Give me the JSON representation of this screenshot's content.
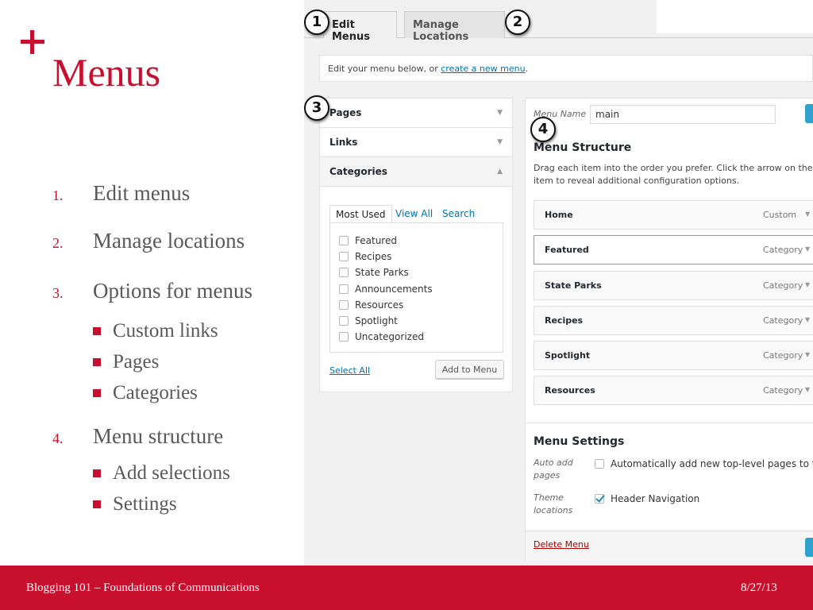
{
  "slide": {
    "title": "Menus",
    "outline": [
      {
        "num": "1.",
        "text": "Edit menus",
        "subs": []
      },
      {
        "num": "2.",
        "text": "Manage locations",
        "subs": []
      },
      {
        "num": "3.",
        "text": "Options for menus",
        "subs": [
          "Custom links",
          "Pages",
          "Categories"
        ]
      },
      {
        "num": "4.",
        "text": "Menu structure",
        "subs": [
          "Add selections",
          "Settings"
        ]
      }
    ],
    "footer": "Blogging 101 – Foundations of Communications",
    "date": "8/27/13",
    "accent_color": "#c8102e"
  },
  "screenshot": {
    "tabs": [
      "Edit Menus",
      "Manage Locations"
    ],
    "notice": {
      "prefix": "Edit your menu below, or ",
      "link": "create a new menu",
      "suffix": "."
    },
    "sections": {
      "pages": "Pages",
      "links": "Links",
      "categories": "Categories"
    },
    "category_tabs": [
      "Most Used",
      "View All",
      "Search"
    ],
    "categories": [
      "Featured",
      "Recipes",
      "State Parks",
      "Announcements",
      "Resources",
      "Spotlight",
      "Uncategorized"
    ],
    "select_all": "Select All",
    "add_to_menu": "Add to Menu",
    "menu_name_label": "Menu Name",
    "menu_name_value": "main",
    "menu_structure_title": "Menu Structure",
    "menu_structure_desc_1": "Drag each item into the order you prefer. Click the arrow on the righ",
    "menu_structure_desc_2": "item to reveal additional configuration options.",
    "menu_items": [
      {
        "label": "Home",
        "type": "Custom"
      },
      {
        "label": "Featured",
        "type": "Category"
      },
      {
        "label": "State Parks",
        "type": "Category"
      },
      {
        "label": "Recipes",
        "type": "Category"
      },
      {
        "label": "Spotlight",
        "type": "Category"
      },
      {
        "label": "Resources",
        "type": "Category"
      }
    ],
    "menu_settings_title": "Menu Settings",
    "auto_add_label": "Auto add pages",
    "auto_add_option": "Automatically add new top-level pages to this me",
    "theme_locations_label": "Theme locations",
    "header_navigation": "Header Navigation",
    "delete_menu": "Delete Menu",
    "badges": [
      "1",
      "2",
      "3",
      "4"
    ],
    "link_color": "#0073aa",
    "primary_button_color": "#2ea2cc"
  }
}
